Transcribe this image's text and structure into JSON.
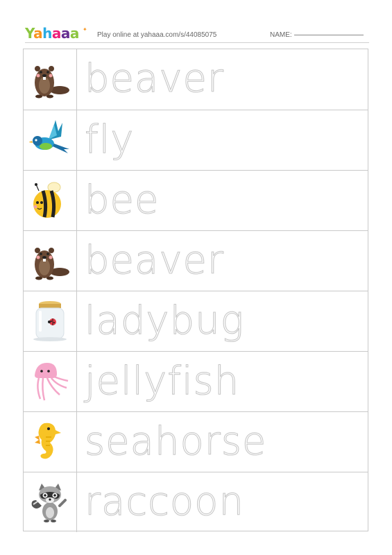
{
  "header": {
    "logo": "Yahaaa",
    "play_text": "Play online at yahaaa.com/s/44085075",
    "name_label": "NAME:"
  },
  "rows": [
    {
      "word": "beaver",
      "icon": "beaver-icon"
    },
    {
      "word": "fly",
      "icon": "bird-icon"
    },
    {
      "word": "bee",
      "icon": "bee-icon"
    },
    {
      "word": "beaver",
      "icon": "beaver-icon"
    },
    {
      "word": "ladybug",
      "icon": "ladybug-jar-icon"
    },
    {
      "word": "jellyfish",
      "icon": "jellyfish-icon"
    },
    {
      "word": "seahorse",
      "icon": "seahorse-icon"
    },
    {
      "word": "raccoon",
      "icon": "raccoon-icon"
    }
  ],
  "colors": {
    "trace_outline": "#c8c8c8",
    "border": "#c9c9c9"
  }
}
